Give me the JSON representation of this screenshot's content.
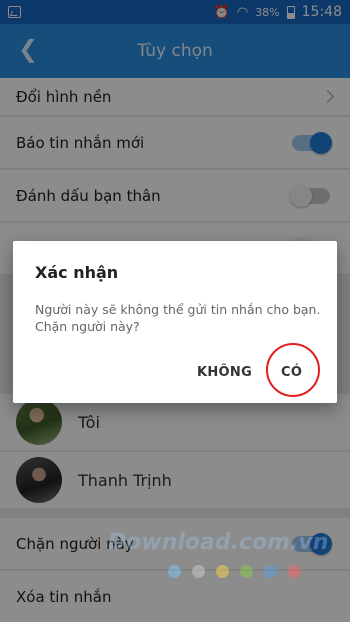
{
  "status_bar": {
    "battery": "38%",
    "time": "15:48"
  },
  "app_bar": {
    "title": "Tùy chọn"
  },
  "settings": {
    "change_background": "Đổi hình nền",
    "new_message_notify": {
      "label": "Báo tin nhắn mới",
      "on": true
    },
    "mark_best_friend": {
      "label": "Đánh dấu bạn thân",
      "on": false
    },
    "hidden_row": {
      "on": false
    }
  },
  "members": [
    {
      "name": "Tôi"
    },
    {
      "name": "Thanh Trịnh"
    }
  ],
  "bottom": {
    "block_user": {
      "label": "Chặn người này",
      "on": true
    },
    "delete_messages": "Xóa tin nhắn"
  },
  "dialog": {
    "title": "Xác nhận",
    "message": "Người này sẽ không thể gửi tin nhắn cho bạn. Chặn người này?",
    "no_label": "KHÔNG",
    "yes_label": "CÓ"
  },
  "watermark": {
    "text": "Download.com.vn",
    "dot_colors": [
      "#7ec3f0",
      "#c8c8c8",
      "#f0d050",
      "#8cc850",
      "#5aa0e0",
      "#f06a6a"
    ]
  },
  "colors": {
    "accent": "#2a8ce0",
    "status_bar": "#1668c0",
    "highlight_circle": "#e02020"
  }
}
